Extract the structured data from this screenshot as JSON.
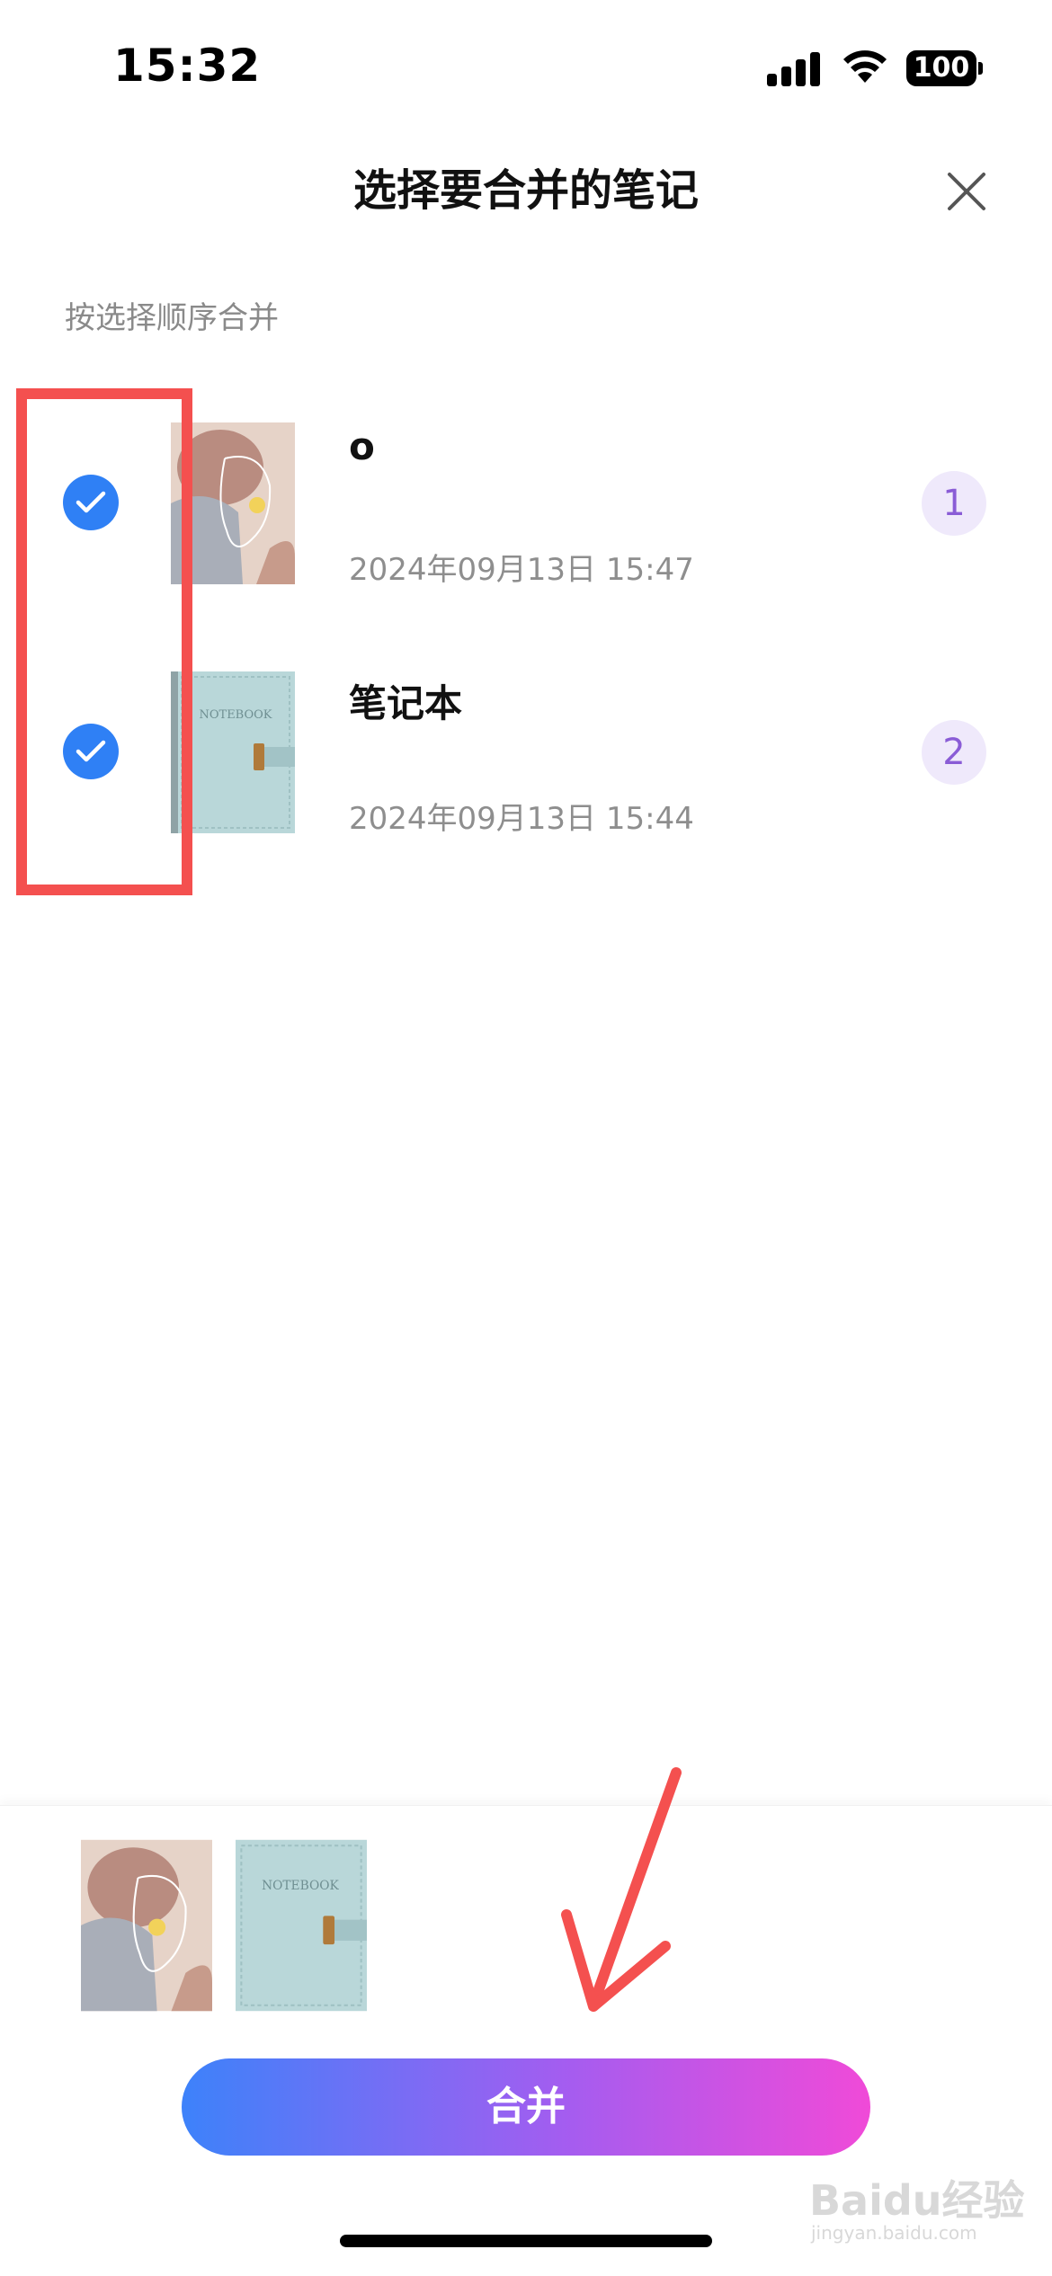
{
  "status_bar": {
    "time": "15:32",
    "battery": "100"
  },
  "header": {
    "title": "选择要合并的笔记",
    "close_icon": "close-icon"
  },
  "hint": "按选择顺序合并",
  "notes": [
    {
      "title": "o",
      "date": "2024年09月13日 15:47",
      "order": "1",
      "checked": true,
      "cover": "portrait-art"
    },
    {
      "title": "笔记本",
      "date": "2024年09月13日 15:44",
      "order": "2",
      "checked": true,
      "cover": "notebook-cover"
    }
  ],
  "cover_text": "NOTEBOOK",
  "merge_button": {
    "label": "合并"
  },
  "watermark": {
    "main": "Baidu经验",
    "sub": "jingyan.baidu.com"
  },
  "colors": {
    "check": "#2f80f5",
    "badge_text": "#8a5cd6",
    "annotation": "#f4504f"
  }
}
